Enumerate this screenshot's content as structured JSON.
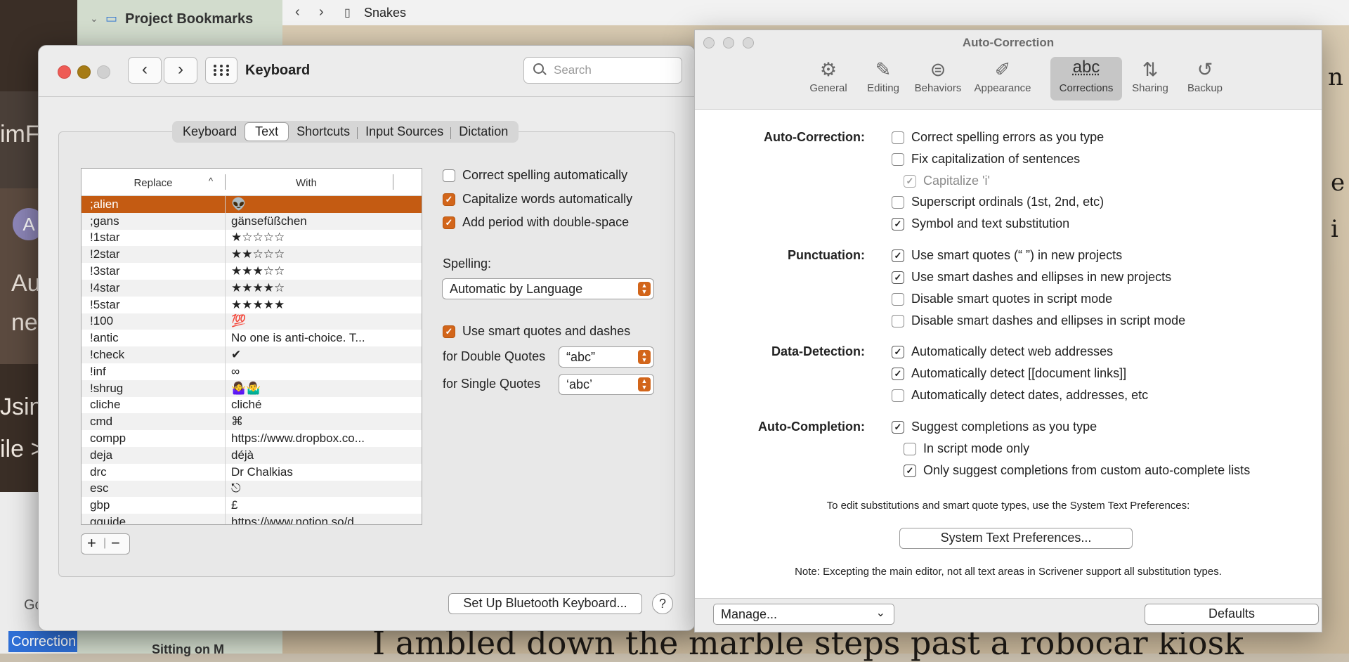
{
  "background": {
    "sidebar_title": "Project Bookmarks",
    "sidebar_bottom": "Sitting on M",
    "editor_title": "Snakes",
    "editor_story": "I ambled down the marble steps past a robocar kiosk",
    "left_fragments": [
      "imF",
      "A",
      "Au",
      "ne",
      "Jsin",
      "ile >",
      "Go"
    ],
    "correction_tab": "Correction",
    "right_fragments": [
      "n",
      "e",
      "i"
    ]
  },
  "keyboard": {
    "title": "Keyboard",
    "search_placeholder": "Search",
    "tabs": [
      {
        "label": "Keyboard",
        "active": false
      },
      {
        "label": "Text",
        "active": true
      },
      {
        "label": "Shortcuts",
        "active": false
      },
      {
        "label": "Input Sources",
        "active": false
      },
      {
        "label": "Dictation",
        "active": false
      }
    ],
    "table": {
      "col_replace": "Replace",
      "col_with": "With",
      "rows": [
        {
          "replace": ";alien",
          "with": "👽",
          "selected": true
        },
        {
          "replace": ";gans",
          "with": "gänsefüßchen"
        },
        {
          "replace": "!1star",
          "with": "★☆☆☆☆"
        },
        {
          "replace": "!2star",
          "with": "★★☆☆☆"
        },
        {
          "replace": "!3star",
          "with": "★★★☆☆"
        },
        {
          "replace": "!4star",
          "with": "★★★★☆"
        },
        {
          "replace": "!5star",
          "with": "★★★★★"
        },
        {
          "replace": "!100",
          "with": "💯"
        },
        {
          "replace": "!antic",
          "with": "No one is anti-choice. T..."
        },
        {
          "replace": "!check",
          "with": "✔"
        },
        {
          "replace": "!inf",
          "with": "∞"
        },
        {
          "replace": "!shrug",
          "with": "🤷‍♀️🤷‍♂️"
        },
        {
          "replace": "cliche",
          "with": "cliché"
        },
        {
          "replace": "cmd",
          "with": "⌘"
        },
        {
          "replace": "compp",
          "with": "https://www.dropbox.co..."
        },
        {
          "replace": "deja",
          "with": "déjà"
        },
        {
          "replace": "drc",
          "with": "Dr Chalkias"
        },
        {
          "replace": "esc",
          "with": "⎋"
        },
        {
          "replace": "gbp",
          "with": "£"
        },
        {
          "replace": "gguide",
          "with": "https://www.notion.so/d..."
        }
      ]
    },
    "add_label": "+",
    "remove_label": "−",
    "options": [
      {
        "label": "Correct spelling automatically",
        "checked": false
      },
      {
        "label": "Capitalize words automatically",
        "checked": true
      },
      {
        "label": "Add period with double-space",
        "checked": true
      }
    ],
    "spelling_label": "Spelling:",
    "spelling_value": "Automatic by Language",
    "smart_quotes": {
      "label": "Use smart quotes and dashes",
      "checked": true
    },
    "double_quotes_label": "for Double Quotes",
    "double_quotes_value": "“abc”",
    "single_quotes_label": "for Single Quotes",
    "single_quotes_value": "‘abc’",
    "bluetooth_button": "Set Up Bluetooth Keyboard...",
    "help_label": "?"
  },
  "autocorrection": {
    "title": "Auto-Correction",
    "toolbar": [
      {
        "label": "General",
        "icon": "gear-icon",
        "glyph": "⚙"
      },
      {
        "label": "Editing",
        "icon": "pencil-square-icon",
        "glyph": "✎"
      },
      {
        "label": "Behaviors",
        "icon": "toggles-icon",
        "glyph": "⊜"
      },
      {
        "label": "Appearance",
        "icon": "brush-icon",
        "glyph": "✐"
      },
      {
        "label": "Corrections",
        "icon": "abc-icon",
        "glyph": "abc",
        "active": true
      },
      {
        "label": "Sharing",
        "icon": "arrows-updown-icon",
        "glyph": "⇅"
      },
      {
        "label": "Backup",
        "icon": "restore-icon",
        "glyph": "↺"
      }
    ],
    "sections": [
      {
        "title": "Auto-Correction:",
        "items": [
          {
            "label": "Correct spelling errors as you type",
            "checked": false
          },
          {
            "label": "Fix capitalization of sentences",
            "checked": false
          },
          {
            "label": "Capitalize 'i'",
            "checked": true,
            "disabled": true,
            "indent": true
          },
          {
            "label": "Superscript ordinals (1st, 2nd, etc)",
            "checked": false
          },
          {
            "label": "Symbol and text substitution",
            "checked": true
          }
        ]
      },
      {
        "title": "Punctuation:",
        "items": [
          {
            "label": "Use smart quotes (“ ”) in new projects",
            "checked": true
          },
          {
            "label": "Use smart dashes and ellipses in new projects",
            "checked": true
          },
          {
            "label": "Disable smart quotes in script mode",
            "checked": false
          },
          {
            "label": "Disable smart dashes and ellipses in script mode",
            "checked": false
          }
        ]
      },
      {
        "title": "Data-Detection:",
        "items": [
          {
            "label": "Automatically detect web addresses",
            "checked": true
          },
          {
            "label": "Automatically detect [[document links]]",
            "checked": true
          },
          {
            "label": "Automatically detect dates, addresses, etc",
            "checked": false
          }
        ]
      },
      {
        "title": "Auto-Completion:",
        "items": [
          {
            "label": "Suggest completions as you type",
            "checked": true
          },
          {
            "label": "In script mode only",
            "checked": false,
            "indent": true
          },
          {
            "label": "Only suggest completions from custom auto-complete lists",
            "checked": true,
            "indent": true
          }
        ]
      }
    ],
    "note_top": "To edit substitutions and smart quote types, use the System Text Preferences:",
    "system_button": "System Text Preferences...",
    "note_bottom": "Note: Excepting the main editor, not all text areas in Scrivener support all substitution types.",
    "manage_label": "Manage...",
    "defaults_label": "Defaults"
  }
}
